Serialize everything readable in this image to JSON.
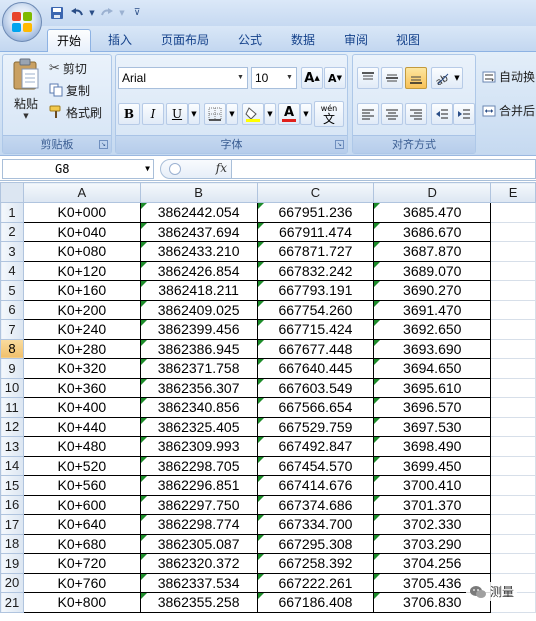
{
  "qat": {
    "save_icon": "save-icon",
    "undo_icon": "undo-icon",
    "redo_icon": "redo-icon",
    "customize_icon": "customize-qat-icon"
  },
  "tabs": [
    {
      "label": "开始",
      "active": true
    },
    {
      "label": "插入",
      "active": false
    },
    {
      "label": "页面布局",
      "active": false
    },
    {
      "label": "公式",
      "active": false
    },
    {
      "label": "数据",
      "active": false
    },
    {
      "label": "审阅",
      "active": false
    },
    {
      "label": "视图",
      "active": false
    }
  ],
  "clipboard": {
    "paste_label": "粘贴",
    "cut_label": "剪切",
    "copy_label": "复制",
    "format_painter_label": "格式刷",
    "group_label": "剪贴板"
  },
  "font": {
    "font_name": "Arial",
    "font_size": "10",
    "bold": "B",
    "italic": "I",
    "underline": "U",
    "wen_label": "wén",
    "wen_char": "文",
    "group_label": "字体",
    "font_color": "#e0201b",
    "fill_color": "#ffff00"
  },
  "alignment": {
    "group_label": "对齐方式",
    "wrap_label": "自动换",
    "merge_label": "合并后"
  },
  "formula_bar": {
    "name_box": "G8",
    "fx": "fx",
    "content": ""
  },
  "columns": [
    "A",
    "B",
    "C",
    "D",
    "E"
  ],
  "selected_row": 8,
  "rows": [
    {
      "n": "1",
      "a": "K0+000",
      "b": "3862442.054",
      "c": "667951.236",
      "d": "3685.470"
    },
    {
      "n": "2",
      "a": "K0+040",
      "b": "3862437.694",
      "c": "667911.474",
      "d": "3686.670"
    },
    {
      "n": "3",
      "a": "K0+080",
      "b": "3862433.210",
      "c": "667871.727",
      "d": "3687.870"
    },
    {
      "n": "4",
      "a": "K0+120",
      "b": "3862426.854",
      "c": "667832.242",
      "d": "3689.070"
    },
    {
      "n": "5",
      "a": "K0+160",
      "b": "3862418.211",
      "c": "667793.191",
      "d": "3690.270"
    },
    {
      "n": "6",
      "a": "K0+200",
      "b": "3862409.025",
      "c": "667754.260",
      "d": "3691.470"
    },
    {
      "n": "7",
      "a": "K0+240",
      "b": "3862399.456",
      "c": "667715.424",
      "d": "3692.650"
    },
    {
      "n": "8",
      "a": "K0+280",
      "b": "3862386.945",
      "c": "667677.448",
      "d": "3693.690"
    },
    {
      "n": "9",
      "a": "K0+320",
      "b": "3862371.758",
      "c": "667640.445",
      "d": "3694.650"
    },
    {
      "n": "10",
      "a": "K0+360",
      "b": "3862356.307",
      "c": "667603.549",
      "d": "3695.610"
    },
    {
      "n": "11",
      "a": "K0+400",
      "b": "3862340.856",
      "c": "667566.654",
      "d": "3696.570"
    },
    {
      "n": "12",
      "a": "K0+440",
      "b": "3862325.405",
      "c": "667529.759",
      "d": "3697.530"
    },
    {
      "n": "13",
      "a": "K0+480",
      "b": "3862309.993",
      "c": "667492.847",
      "d": "3698.490"
    },
    {
      "n": "14",
      "a": "K0+520",
      "b": "3862298.705",
      "c": "667454.570",
      "d": "3699.450"
    },
    {
      "n": "15",
      "a": "K0+560",
      "b": "3862296.851",
      "c": "667414.676",
      "d": "3700.410"
    },
    {
      "n": "16",
      "a": "K0+600",
      "b": "3862297.750",
      "c": "667374.686",
      "d": "3701.370"
    },
    {
      "n": "17",
      "a": "K0+640",
      "b": "3862298.774",
      "c": "667334.700",
      "d": "3702.330"
    },
    {
      "n": "18",
      "a": "K0+680",
      "b": "3862305.087",
      "c": "667295.308",
      "d": "3703.290"
    },
    {
      "n": "19",
      "a": "K0+720",
      "b": "3862320.372",
      "c": "667258.392",
      "d": "3704.256"
    },
    {
      "n": "20",
      "a": "K0+760",
      "b": "3862337.534",
      "c": "667222.261",
      "d": "3705.436"
    },
    {
      "n": "21",
      "a": "K0+800",
      "b": "3862355.258",
      "c": "667186.408",
      "d": "3706.830"
    }
  ],
  "watermark": {
    "text": "测量"
  }
}
